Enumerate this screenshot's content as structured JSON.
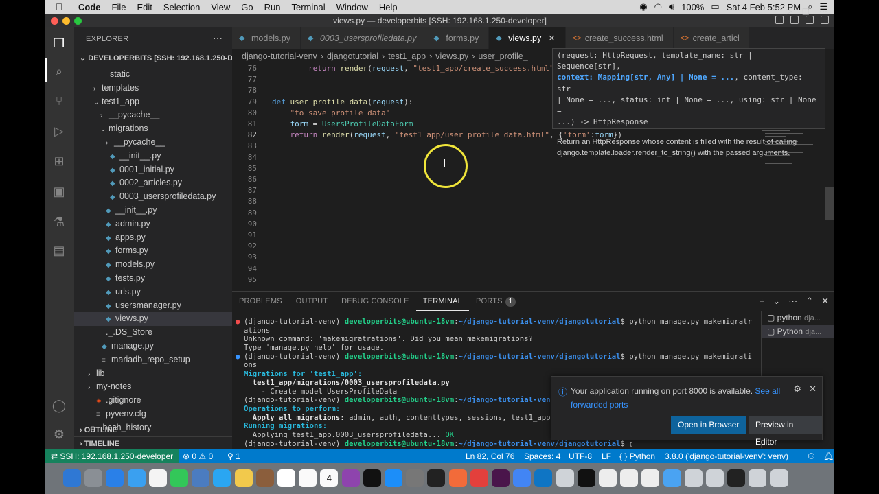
{
  "mac_menu": {
    "apple": "",
    "items": [
      "Code",
      "File",
      "Edit",
      "Selection",
      "View",
      "Go",
      "Run",
      "Terminal",
      "Window",
      "Help"
    ],
    "battery": "100%",
    "clock": "Sat 4 Feb  5:52 PM"
  },
  "window": {
    "title": "views.py — developerbits [SSH: 192.168.1.250-developer]"
  },
  "sidebar": {
    "title": "EXPLORER",
    "more": "···",
    "section": "DEVELOPERBITS [SSH: 192.168.1.250-D...",
    "tree": [
      {
        "label": "static",
        "indent": 40,
        "chev": "",
        "icon": ""
      },
      {
        "label": "templates",
        "indent": 28,
        "chev": "›",
        "icon": ""
      },
      {
        "label": "test1_app",
        "indent": 28,
        "chev": "⌄",
        "icon": ""
      },
      {
        "label": "__pycache__",
        "indent": 38,
        "chev": "›",
        "icon": ""
      },
      {
        "label": "migrations",
        "indent": 38,
        "chev": "⌄",
        "icon": ""
      },
      {
        "label": "__pycache__",
        "indent": 46,
        "chev": "›",
        "icon": ""
      },
      {
        "label": "__init__.py",
        "indent": 40,
        "chev": "",
        "icon": "py"
      },
      {
        "label": "0001_initial.py",
        "indent": 40,
        "chev": "",
        "icon": "py"
      },
      {
        "label": "0002_articles.py",
        "indent": 40,
        "chev": "",
        "icon": "py"
      },
      {
        "label": "0003_usersprofiledata.py",
        "indent": 40,
        "chev": "",
        "icon": "py"
      },
      {
        "label": "__init__.py",
        "indent": 34,
        "chev": "",
        "icon": "py"
      },
      {
        "label": "admin.py",
        "indent": 34,
        "chev": "",
        "icon": "py"
      },
      {
        "label": "apps.py",
        "indent": 34,
        "chev": "",
        "icon": "py"
      },
      {
        "label": "forms.py",
        "indent": 34,
        "chev": "",
        "icon": "py"
      },
      {
        "label": "models.py",
        "indent": 34,
        "chev": "",
        "icon": "py"
      },
      {
        "label": "tests.py",
        "indent": 34,
        "chev": "",
        "icon": "py"
      },
      {
        "label": "urls.py",
        "indent": 34,
        "chev": "",
        "icon": "py"
      },
      {
        "label": "usersmanager.py",
        "indent": 34,
        "chev": "",
        "icon": "py"
      },
      {
        "label": "views.py",
        "indent": 34,
        "chev": "",
        "icon": "py",
        "selected": true
      },
      {
        "label": "._.DS_Store",
        "indent": 34,
        "chev": "",
        "icon": ""
      },
      {
        "label": "manage.py",
        "indent": 28,
        "chev": "",
        "icon": "py"
      },
      {
        "label": "mariadb_repo_setup",
        "indent": 28,
        "chev": "",
        "icon": "txt"
      },
      {
        "label": "lib",
        "indent": 20,
        "chev": "›",
        "icon": ""
      },
      {
        "label": "my-notes",
        "indent": 20,
        "chev": "›",
        "icon": ""
      },
      {
        "label": ".gitignore",
        "indent": 20,
        "chev": "",
        "icon": "git"
      },
      {
        "label": "pyvenv.cfg",
        "indent": 20,
        "chev": "",
        "icon": "cfg"
      },
      {
        "label": ".bash_history",
        "indent": 12,
        "chev": "",
        "icon": "txt"
      }
    ],
    "outline": "OUTLINE",
    "timeline": "TIMELINE"
  },
  "tabs": [
    {
      "label": "models.py",
      "type": "py",
      "italic": false,
      "active": false
    },
    {
      "label": "0003_usersprofiledata.py",
      "type": "py",
      "italic": true,
      "active": false
    },
    {
      "label": "forms.py",
      "type": "py",
      "italic": false,
      "active": false
    },
    {
      "label": "views.py",
      "type": "py",
      "italic": false,
      "active": true
    },
    {
      "label": "create_success.html",
      "type": "html",
      "italic": false,
      "active": false
    },
    {
      "label": "create_articl",
      "type": "html",
      "italic": false,
      "active": false
    }
  ],
  "breadcrumb": [
    "django-tutorial-venv",
    "djangotutorial",
    "test1_app",
    "views.py",
    "user_profile_"
  ],
  "editor": {
    "current_line": 82,
    "lines": [
      {
        "n": 76,
        "tokens": [
          [
            "pl",
            "        "
          ],
          [
            "kw",
            "return"
          ],
          [
            "pl",
            " "
          ],
          [
            "fn",
            "render"
          ],
          [
            "pl",
            "("
          ],
          [
            "var",
            "request"
          ],
          [
            "pl",
            ", "
          ],
          [
            "str",
            "\"test1_app/create_success.html\""
          ],
          [
            "pl",
            ", {})"
          ]
        ]
      },
      {
        "n": 77,
        "tokens": []
      },
      {
        "n": 78,
        "tokens": []
      },
      {
        "n": 79,
        "tokens": [
          [
            "def",
            "def"
          ],
          [
            "pl",
            " "
          ],
          [
            "fn",
            "user_profile_data"
          ],
          [
            "pl",
            "("
          ],
          [
            "var",
            "request"
          ],
          [
            "pl",
            "):"
          ]
        ]
      },
      {
        "n": 80,
        "tokens": [
          [
            "pl",
            "    "
          ],
          [
            "str",
            "\"to save profile data\""
          ]
        ]
      },
      {
        "n": 81,
        "tokens": [
          [
            "pl",
            "    "
          ],
          [
            "var",
            "form"
          ],
          [
            "pl",
            " = "
          ],
          [
            "cls",
            "UsersProfileDataForm"
          ]
        ]
      },
      {
        "n": 82,
        "tokens": [
          [
            "pl",
            "    "
          ],
          [
            "kw",
            "return"
          ],
          [
            "pl",
            " "
          ],
          [
            "fn",
            "render"
          ],
          [
            "pl",
            "("
          ],
          [
            "var",
            "request"
          ],
          [
            "pl",
            ", "
          ],
          [
            "str",
            "\"test1_app/user_profile_data.html\""
          ],
          [
            "pl",
            ", {"
          ],
          [
            "str",
            "'form'"
          ],
          [
            "pl",
            ":"
          ],
          [
            "var",
            "form"
          ],
          [
            "pl",
            "})"
          ]
        ]
      },
      {
        "n": 83,
        "tokens": []
      },
      {
        "n": 84,
        "tokens": []
      },
      {
        "n": 85,
        "tokens": []
      },
      {
        "n": 86,
        "tokens": []
      },
      {
        "n": 87,
        "tokens": []
      },
      {
        "n": 88,
        "tokens": []
      },
      {
        "n": 89,
        "tokens": []
      },
      {
        "n": 90,
        "tokens": []
      },
      {
        "n": 91,
        "tokens": []
      },
      {
        "n": 92,
        "tokens": []
      },
      {
        "n": 93,
        "tokens": []
      },
      {
        "n": 94,
        "tokens": []
      },
      {
        "n": 95,
        "tokens": []
      }
    ]
  },
  "hover": {
    "sig_1": "(request: HttpRequest, template_name: str | Sequence[str],",
    "sig_2_hl": "context: Mapping[str, Any] | None = ...",
    "sig_2_rest": ", content_type: str",
    "sig_3": "| None = ..., status: int | None = ..., using: str | None =",
    "sig_4": "...) -> HttpResponse",
    "desc": "Return an HttpResponse whose content is filled with the result of calling django.template.loader.render_to_string() with the passed arguments."
  },
  "panel": {
    "tabs": [
      "PROBLEMS",
      "OUTPUT",
      "DEBUG CONSOLE",
      "TERMINAL",
      "PORTS"
    ],
    "active_tab": "TERMINAL",
    "ports_badge": "1",
    "terminal_lines": [
      {
        "dot": "red",
        "segs": [
          [
            "",
            "(django-tutorial-venv) "
          ],
          [
            "tg",
            "developerbits@ubuntu-18vm"
          ],
          [
            "",
            ":"
          ],
          [
            "tb",
            "~/django-tutorial-venv/djangotutorial"
          ],
          [
            "",
            "$ python manage.py makemigratr"
          ]
        ]
      },
      {
        "dot": "",
        "segs": [
          [
            "",
            "ations"
          ]
        ]
      },
      {
        "dot": "",
        "segs": [
          [
            "",
            "Unknown command: 'makemigratrations'. Did you mean makemigrations?"
          ]
        ]
      },
      {
        "dot": "",
        "segs": [
          [
            "",
            "Type 'manage.py help' for usage."
          ]
        ]
      },
      {
        "dot": "blue",
        "segs": [
          [
            "",
            "(django-tutorial-venv) "
          ],
          [
            "tg",
            "developerbits@ubuntu-18vm"
          ],
          [
            "",
            ":"
          ],
          [
            "tb",
            "~/django-tutorial-venv/djangotutorial"
          ],
          [
            "",
            "$ python manage.py makemigrati"
          ]
        ]
      },
      {
        "dot": "",
        "segs": [
          [
            "",
            "ons"
          ]
        ]
      },
      {
        "dot": "",
        "segs": [
          [
            "tcyan",
            "Migrations for 'test1_app':"
          ]
        ]
      },
      {
        "dot": "",
        "segs": [
          [
            "tbold",
            "  test1_app/migrations/0003_usersprofiledata.py"
          ]
        ]
      },
      {
        "dot": "",
        "segs": [
          [
            "",
            "    - Create model UsersProfileData"
          ]
        ]
      },
      {
        "dot": "",
        "segs": [
          [
            "",
            "(django-tutorial-venv) "
          ],
          [
            "tg",
            "developerbits@ubuntu-18vm"
          ],
          [
            "",
            ":"
          ],
          [
            "tb",
            "~/django-tutorial-venv/djangotutorial"
          ]
        ]
      },
      {
        "dot": "",
        "segs": [
          [
            "tcyan",
            "Operations to perform:"
          ]
        ]
      },
      {
        "dot": "",
        "segs": [
          [
            "tbold",
            "  Apply all migrations: "
          ],
          [
            "",
            "admin, auth, contenttypes, sessions, test1_app"
          ]
        ]
      },
      {
        "dot": "",
        "segs": [
          [
            "tcyan",
            "Running migrations:"
          ]
        ]
      },
      {
        "dot": "",
        "segs": [
          [
            "",
            "  Applying test1_app.0003_usersprofiledata... "
          ],
          [
            "tgreen",
            "OK"
          ]
        ]
      },
      {
        "dot": "",
        "segs": [
          [
            "",
            "(django-tutorial-venv) "
          ],
          [
            "tg",
            "developerbits@ubuntu-18vm"
          ],
          [
            "",
            ":"
          ],
          [
            "tb",
            "~/django-tutorial-venv/djangotutorial"
          ],
          [
            "",
            "$ "
          ]
        ]
      }
    ],
    "terminal_list": [
      {
        "label": "python",
        "sub": "dja..."
      },
      {
        "label": "Python",
        "sub": "dja..."
      }
    ]
  },
  "notification": {
    "message": "Your application running on port 8000 is available. ",
    "link_1": "See all",
    "link_2": "forwarded ports",
    "primary_button": "Open in Browser",
    "secondary_button": "Preview in Editor"
  },
  "status": {
    "remote": "SSH: 192.168.1.250-developer",
    "problems": "⊗ 0 ⚠ 0",
    "ports": "⚲ 1",
    "position": "Ln 82, Col 76",
    "spaces": "Spaces: 4",
    "encoding": "UTF-8",
    "eol": "LF",
    "language": "Python",
    "interpreter": "3.8.0 ('django-tutorial-venv': venv)"
  },
  "dock": {
    "calendar_day": "4",
    "colors": [
      "#2f78d4",
      "#8a8f95",
      "#2a80e8",
      "#3aa0f0",
      "#f4f4f4",
      "#33c759",
      "#4b7cc0",
      "#2aa6f2",
      "#f2c94c",
      "#8b5e3c",
      "#ffffff",
      "#fafafa",
      "#fa2d48",
      "#8e44ad",
      "#111111",
      "#1c8ef9",
      "#777777",
      "#222222",
      "#f26b3a",
      "#e3403c",
      "#4a154b",
      "#4285f4",
      "#0f75c4",
      "#cfd3d8",
      "#111111",
      "#ededed",
      "#ededed",
      "#ededed",
      "#4aa3f2",
      "#cfd3d8",
      "#cfd3d8",
      "#222222",
      "#cfd3d8",
      "#cfd3d8"
    ]
  }
}
